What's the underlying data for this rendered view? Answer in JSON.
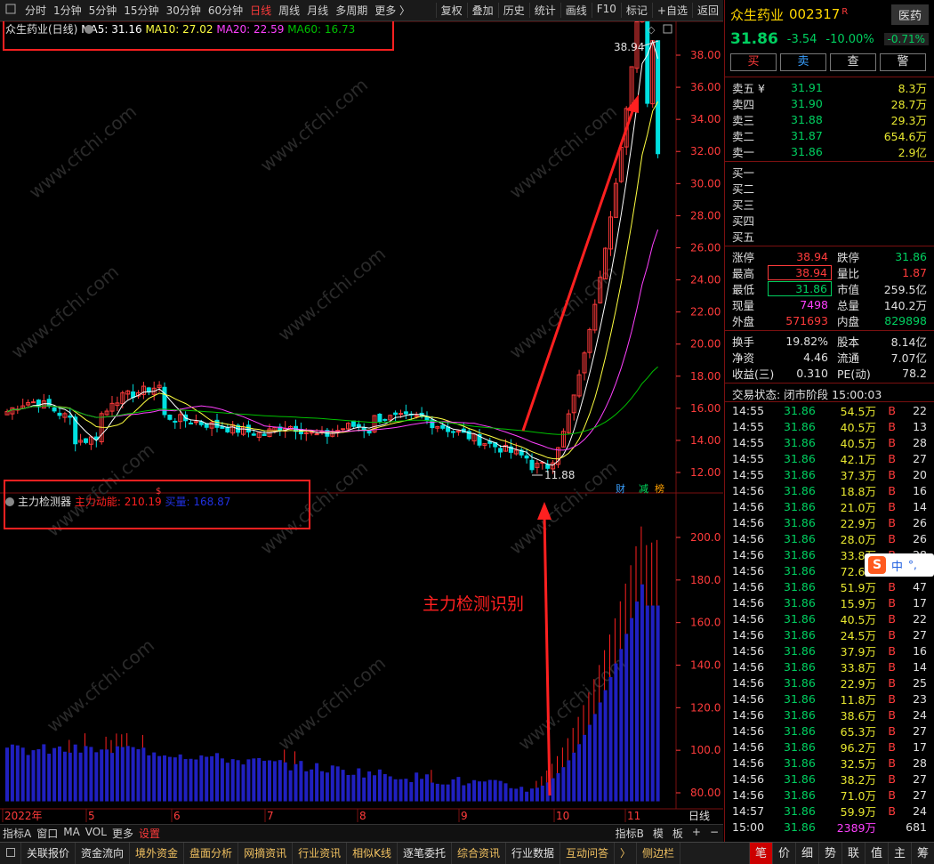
{
  "toolbar": {
    "periods": [
      "分时",
      "1分钟",
      "5分钟",
      "15分钟",
      "30分钟",
      "60分钟",
      "日线",
      "周线",
      "月线",
      "多周期",
      "更多 〉"
    ],
    "active_period": "日线",
    "actions": [
      "复权",
      "叠加",
      "历史",
      "统计",
      "画线",
      "F10",
      "标记",
      "+自选",
      "返回"
    ]
  },
  "chart": {
    "title": "众生药业(日线)",
    "ma5": "MA5: 31.16",
    "ma10": "MA10: 27.02",
    "ma20": "MA20: 22.59",
    "ma60": "MA60: 16.73",
    "high_label": "38.94",
    "low_label": "11.88",
    "price_axis": [
      "38.00",
      "36.00",
      "34.00",
      "32.00",
      "30.00",
      "28.00",
      "26.00",
      "24.00",
      "22.00",
      "20.00",
      "18.00",
      "16.00",
      "14.00",
      "12.00"
    ],
    "markers": [
      "财",
      "减",
      "榜"
    ],
    "indicator_name": "主力检测器",
    "indicator_v1": "主力动能: 210.19",
    "indicator_v2": "买量: 168.87",
    "indicator_axis": [
      "200.0",
      "180.0",
      "160.0",
      "140.0",
      "120.0",
      "100.0",
      "80.00"
    ],
    "annotation": "主力检测识别",
    "x_labels": [
      "2022年",
      "5",
      "6",
      "7",
      "8",
      "9",
      "10",
      "11"
    ],
    "period_label": "日线",
    "watermark": "www.cfchi.com",
    "colors": {
      "up": "#ff3b3b",
      "down": "#00e0e0",
      "ma5": "#ffffff",
      "ma10": "#ffff40",
      "ma20": "#ff40ff",
      "ma60": "#00c000",
      "vol": "#2020c0",
      "annotation": "#ff2020"
    }
  },
  "tabs": [
    "指标A",
    "窗口",
    "MA",
    "VOL",
    "更多",
    "设置"
  ],
  "tabs_right": [
    "指标B",
    "模",
    "板",
    "+",
    "−"
  ],
  "status_items": [
    "关联报价",
    "资金流向",
    "境外资金",
    "盘面分析",
    "网摘资讯",
    "行业资讯",
    "相似K线",
    "逐笔委托",
    "综合资讯",
    "行业数据",
    "互动问答",
    "〉",
    "侧边栏"
  ],
  "status_right": [
    "笔",
    "价",
    "细",
    "势",
    "联",
    "值",
    "主",
    "筹"
  ],
  "quote": {
    "name": "众生药业",
    "code": "002317",
    "flag": "R",
    "sector": "医药",
    "sector_change": "-0.71%",
    "price": "31.86",
    "change": "-3.54",
    "change_pct": "-10.00%",
    "buttons": [
      "买",
      "卖",
      "查",
      "警"
    ],
    "asks": [
      {
        "label": "卖五 ¥",
        "price": "31.91",
        "vol": "8.3万"
      },
      {
        "label": "卖四",
        "price": "31.90",
        "vol": "28.7万"
      },
      {
        "label": "卖三",
        "price": "31.88",
        "vol": "29.3万"
      },
      {
        "label": "卖二",
        "price": "31.87",
        "vol": "654.6万"
      },
      {
        "label": "卖一",
        "price": "31.86",
        "vol": "2.9亿"
      }
    ],
    "bids": [
      "买一",
      "买二",
      "买三",
      "买四",
      "买五"
    ],
    "stats": [
      {
        "l1": "涨停",
        "v1": "38.94",
        "c1": "red",
        "l2": "跌停",
        "v2": "31.86",
        "c2": "green"
      },
      {
        "l1": "最高",
        "v1": "38.94",
        "c1": "red",
        "l2": "量比",
        "v2": "1.87",
        "c2": "red"
      },
      {
        "l1": "最低",
        "v1": "31.86",
        "c1": "green",
        "l2": "市值",
        "v2": "259.5亿",
        "c2": "white"
      },
      {
        "l1": "现量",
        "v1": "7498",
        "c1": "magenta",
        "l2": "总量",
        "v2": "140.2万",
        "c2": "white"
      },
      {
        "l1": "外盘",
        "v1": "571693",
        "c1": "red",
        "l2": "内盘",
        "v2": "829898",
        "c2": "green"
      }
    ],
    "stats2": [
      {
        "l1": "换手",
        "v1": "19.82%",
        "l2": "股本",
        "v2": "8.14亿"
      },
      {
        "l1": "净资",
        "v1": "4.46",
        "l2": "流通",
        "v2": "7.07亿"
      },
      {
        "l1": "收益(三)",
        "v1": "0.310",
        "l2": "PE(动)",
        "v2": "78.2"
      }
    ],
    "trade_status": "交易状态: 闭市阶段 15:00:03",
    "ticks": [
      [
        "14:55",
        "31.86",
        "54.5万",
        "B",
        "22"
      ],
      [
        "14:55",
        "31.86",
        "40.5万",
        "B",
        "13"
      ],
      [
        "14:55",
        "31.86",
        "40.5万",
        "B",
        "28"
      ],
      [
        "14:55",
        "31.86",
        "42.1万",
        "B",
        "27"
      ],
      [
        "14:55",
        "31.86",
        "37.3万",
        "B",
        "20"
      ],
      [
        "14:56",
        "31.86",
        "18.8万",
        "B",
        "16"
      ],
      [
        "14:56",
        "31.86",
        "21.0万",
        "B",
        "14"
      ],
      [
        "14:56",
        "31.86",
        "22.9万",
        "B",
        "26"
      ],
      [
        "14:56",
        "31.86",
        "28.0万",
        "B",
        "26"
      ],
      [
        "14:56",
        "31.86",
        "33.8万",
        "B",
        "28"
      ],
      [
        "14:56",
        "31.86",
        "72.6万",
        "B",
        "29"
      ],
      [
        "14:56",
        "31.86",
        "51.9万",
        "B",
        "47"
      ],
      [
        "14:56",
        "31.86",
        "15.9万",
        "B",
        "17"
      ],
      [
        "14:56",
        "31.86",
        "40.5万",
        "B",
        "22"
      ],
      [
        "14:56",
        "31.86",
        "24.5万",
        "B",
        "27"
      ],
      [
        "14:56",
        "31.86",
        "37.9万",
        "B",
        "16"
      ],
      [
        "14:56",
        "31.86",
        "33.8万",
        "B",
        "14"
      ],
      [
        "14:56",
        "31.86",
        "22.9万",
        "B",
        "25"
      ],
      [
        "14:56",
        "31.86",
        "11.8万",
        "B",
        "23"
      ],
      [
        "14:56",
        "31.86",
        "38.6万",
        "B",
        "24"
      ],
      [
        "14:56",
        "31.86",
        "65.3万",
        "B",
        "27"
      ],
      [
        "14:56",
        "31.86",
        "96.2万",
        "B",
        "17"
      ],
      [
        "14:56",
        "31.86",
        "32.5万",
        "B",
        "28"
      ],
      [
        "14:56",
        "31.86",
        "38.2万",
        "B",
        "27"
      ],
      [
        "14:56",
        "31.86",
        "71.0万",
        "B",
        "27"
      ],
      [
        "14:57",
        "31.86",
        "59.9万",
        "B",
        "24"
      ],
      [
        "15:00",
        "31.86",
        "2389万",
        "",
        "681"
      ]
    ],
    "ime_label": "中"
  }
}
